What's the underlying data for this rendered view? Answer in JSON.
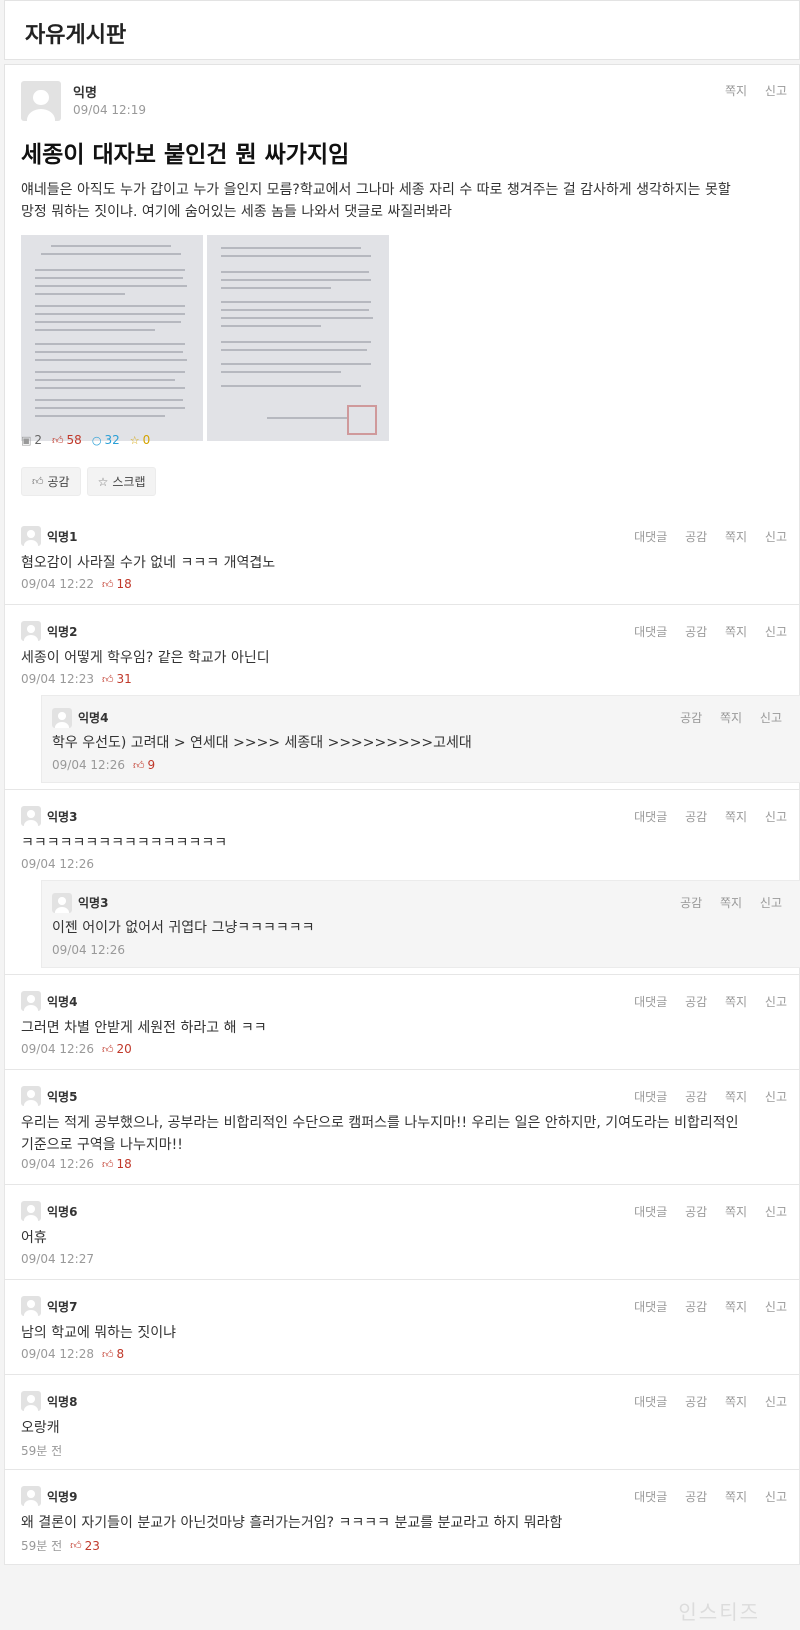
{
  "board": {
    "title": "자유게시판"
  },
  "post": {
    "author": "익명",
    "date": "09/04 12:19",
    "actions": [
      "쪽지",
      "신고"
    ],
    "title": "세종이 대자보 붙인건 뭔 싸가지임",
    "body_line1": "얘네들은 아직도 누가 갑이고 누가 을인지 모름?학교에서 그나마 세종 자리 수 따로 챙겨주는 걸 감사하게 생각하지는 못할",
    "body_line2": "망정 뭐하는 짓이냐. 여기에 숨어있는 세종 놈들 나와서 댓글로 싸질러봐라",
    "stats": {
      "images": "2",
      "likes": "58",
      "comments": "32",
      "scraps": "0"
    },
    "buttons": {
      "like": "공감",
      "scrap": "스크랩"
    }
  },
  "comments": [
    {
      "name": "익명1",
      "text": "혐오감이 사라질 수가 없네 ㅋㅋㅋ 개역겹노",
      "time": "09/04 12:22",
      "likes": "18",
      "actions": [
        "대댓글",
        "공감",
        "쪽지",
        "신고"
      ]
    },
    {
      "name": "익명2",
      "text": "세종이 어떻게 학우임? 같은 학교가 아닌디",
      "time": "09/04 12:23",
      "likes": "31",
      "actions": [
        "대댓글",
        "공감",
        "쪽지",
        "신고"
      ],
      "reply": {
        "name": "익명4",
        "text": "학우 우선도) 고려대 > 연세대 >>>> 세종대 >>>>>>>>>고세대",
        "time": "09/04 12:26",
        "likes": "9",
        "actions": [
          "공감",
          "쪽지",
          "신고"
        ]
      }
    },
    {
      "name": "익명3",
      "text": "ㅋㅋㅋㅋㅋㅋㅋㅋㅋㅋㅋㅋㅋㅋㅋㅋ",
      "time": "09/04 12:26",
      "likes": "",
      "actions": [
        "대댓글",
        "공감",
        "쪽지",
        "신고"
      ],
      "reply": {
        "name": "익명3",
        "text": "이젠 어이가 없어서 귀엽다 그냥ㅋㅋㅋㅋㅋㅋ",
        "time": "09/04 12:26",
        "likes": "",
        "actions": [
          "공감",
          "쪽지",
          "신고"
        ]
      }
    },
    {
      "name": "익명4",
      "text": "그러면 차별 안받게 세원전 하라고 해 ㅋㅋ",
      "time": "09/04 12:26",
      "likes": "20",
      "actions": [
        "대댓글",
        "공감",
        "쪽지",
        "신고"
      ]
    },
    {
      "name": "익명5",
      "text_line1": "우리는 적게 공부했으나, 공부라는 비합리적인 수단으로 캠퍼스를 나누지마!! 우리는 일은 안하지만, 기여도라는 비합리적인",
      "text_line2": "기준으로 구역을 나누지마!!",
      "time": "09/04 12:26",
      "likes": "18",
      "actions": [
        "대댓글",
        "공감",
        "쪽지",
        "신고"
      ]
    },
    {
      "name": "익명6",
      "text": "어휴",
      "time": "09/04 12:27",
      "likes": "",
      "actions": [
        "대댓글",
        "공감",
        "쪽지",
        "신고"
      ]
    },
    {
      "name": "익명7",
      "text": "남의 학교에 뭐하는 짓이냐",
      "time": "09/04 12:28",
      "likes": "8",
      "actions": [
        "대댓글",
        "공감",
        "쪽지",
        "신고"
      ]
    },
    {
      "name": "익명8",
      "text": "오랑캐",
      "time": "59분 전",
      "likes": "",
      "actions": [
        "대댓글",
        "공감",
        "쪽지",
        "신고"
      ]
    },
    {
      "name": "익명9",
      "text": "왜 결론이 자기들이 분교가 아닌것마냥 흘러가는거임? ㅋㅋㅋㅋ 분교를 분교라고 하지 뭐라함",
      "time": "59분 전",
      "likes": "23",
      "actions": [
        "대댓글",
        "공감",
        "쪽지",
        "신고"
      ]
    }
  ],
  "icons": {
    "image": "image-icon",
    "like": "thumbs-up-icon",
    "comment": "comment-icon",
    "scrap": "star-icon"
  },
  "colors": {
    "like": "#c0392b",
    "comment": "#2a9fd6",
    "scrap": "#f1c40f",
    "muted": "#999999"
  },
  "watermark": "인스티즈"
}
